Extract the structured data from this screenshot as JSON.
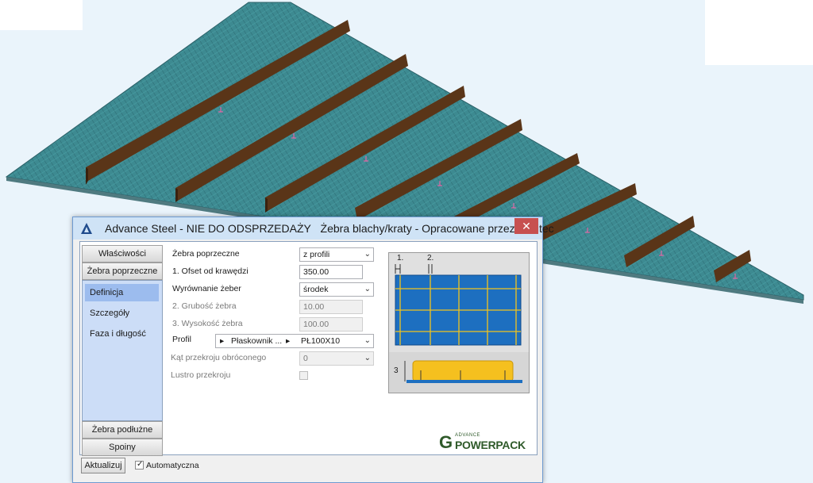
{
  "window": {
    "app_title": "Advance Steel - NIE DO ODSPRZEDAŻY",
    "dialog_title": "Żebra blachy/kraty - Opracowane przez Graitec",
    "close_label": "✕"
  },
  "nav": {
    "sections_top": [
      "Właściwości",
      "Żebra poprzeczne"
    ],
    "items": [
      "Definicja",
      "Szczegóły",
      "Faza i długość"
    ],
    "selected_item": "Definicja",
    "sections_bottom": [
      "Żebra podłużne",
      "Spoiny"
    ]
  },
  "form": {
    "rows": [
      {
        "label": "Żebra poprzeczne",
        "value": "z profili",
        "type": "select",
        "enabled": true
      },
      {
        "label": "1. Ofset od krawędzi",
        "value": "350.00",
        "type": "input",
        "enabled": true
      },
      {
        "label": "Wyrównanie żeber",
        "value": "środek",
        "type": "select",
        "enabled": true
      },
      {
        "label": "2. Grubość żebra",
        "value": "10.00",
        "type": "input",
        "enabled": false
      },
      {
        "label": "3. Wysokość żebra",
        "value": "100.00",
        "type": "input",
        "enabled": false
      },
      {
        "label": "Profil",
        "value_part1": "Płaskownik ...",
        "value_part2": "PŁ100X10",
        "type": "profile",
        "enabled": true
      },
      {
        "label": "Kąt przekroju obróconego",
        "value": "0",
        "type": "select",
        "enabled": false
      },
      {
        "label": "Lustro przekroju",
        "type": "checkbox",
        "checked": false,
        "enabled": false
      }
    ]
  },
  "preview": {
    "labels": [
      "1.",
      "2.",
      "3"
    ]
  },
  "logo": {
    "small": "ADVANCE",
    "main": "POWERPACK",
    "letter": "G"
  },
  "footer": {
    "update_button": "Aktualizuj",
    "auto_checkbox_label": "Automatyczna",
    "auto_checked": true
  },
  "colors": {
    "plate": "#3d8a91",
    "rib": "#5a3518",
    "preview_plate": "#1d6fc0",
    "rib_line": "#f2c31c",
    "titlebar": "#cfe3f6"
  }
}
